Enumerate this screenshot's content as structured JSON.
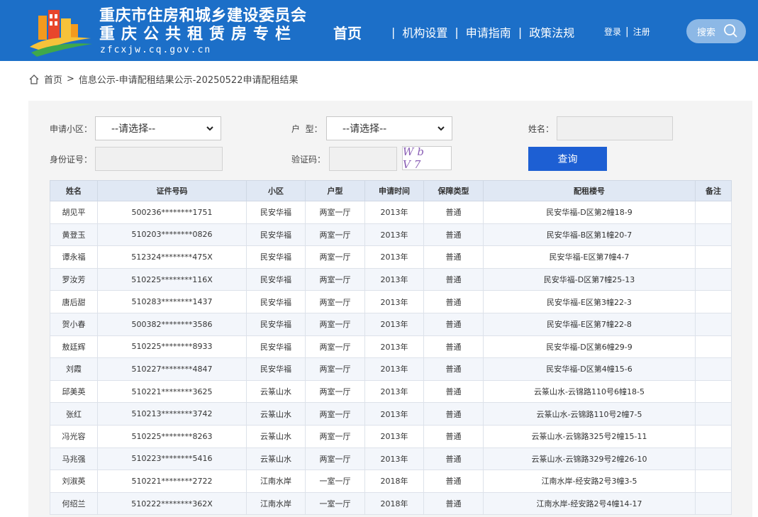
{
  "header": {
    "title": "重庆市住房和城乡建设委员会",
    "subtitle": "重庆公共租赁房专栏",
    "url": "zfcxjw.cq.gov.cn",
    "nav": {
      "home": "首页",
      "items": [
        "机构设置",
        "申请指南",
        "政策法规"
      ],
      "login": "登录",
      "register": "注册"
    },
    "search_label": "搜索"
  },
  "breadcrumb": {
    "home": "首页",
    "path": "信息公示-申请配租结果公示-20250522申请配租结果"
  },
  "form": {
    "community_label": "申请小区：",
    "community_value": "--请选择--",
    "type_label": "户  型：",
    "type_value": "--请选择--",
    "name_label": "姓名：",
    "id_label": "身份证号：",
    "captcha_label": "验证码：",
    "captcha_text": "Wb V7",
    "query_button": "查询"
  },
  "table": {
    "columns": [
      "姓名",
      "证件号码",
      "小区",
      "户型",
      "申请时间",
      "保障类型",
      "配租楼号",
      "备注"
    ],
    "rows": [
      [
        "胡见平",
        "500236********1751",
        "民安华福",
        "两室一厅",
        "2013年",
        "普通",
        "民安华福-D区第2幢18-9",
        ""
      ],
      [
        "黄登玉",
        "510203********0826",
        "民安华福",
        "两室一厅",
        "2013年",
        "普通",
        "民安华福-B区第1幢20-7",
        ""
      ],
      [
        "谭永福",
        "512324********475X",
        "民安华福",
        "两室一厅",
        "2013年",
        "普通",
        "民安华福-E区第7幢4-7",
        ""
      ],
      [
        "罗汝芳",
        "510225********116X",
        "民安华福",
        "两室一厅",
        "2013年",
        "普通",
        "民安华福-D区第7幢25-13",
        ""
      ],
      [
        "唐后甜",
        "510283********1437",
        "民安华福",
        "两室一厅",
        "2013年",
        "普通",
        "民安华福-E区第3幢22-3",
        ""
      ],
      [
        "贺小春",
        "500382********3586",
        "民安华福",
        "两室一厅",
        "2013年",
        "普通",
        "民安华福-E区第7幢22-8",
        ""
      ],
      [
        "敖廷辉",
        "510225********8933",
        "民安华福",
        "两室一厅",
        "2013年",
        "普通",
        "民安华福-D区第6幢29-9",
        ""
      ],
      [
        "刘霞",
        "510227********4847",
        "民安华福",
        "两室一厅",
        "2013年",
        "普通",
        "民安华福-D区第4幢15-6",
        ""
      ],
      [
        "邱美英",
        "510221********3625",
        "云篆山水",
        "两室一厅",
        "2013年",
        "普通",
        "云篆山水-云锦路110号6幢18-5",
        ""
      ],
      [
        "张红",
        "510213********3742",
        "云篆山水",
        "两室一厅",
        "2013年",
        "普通",
        "云篆山水-云锦路110号2幢7-5",
        ""
      ],
      [
        "冯光容",
        "510225********8263",
        "云篆山水",
        "两室一厅",
        "2013年",
        "普通",
        "云篆山水-云锦路325号2幢15-11",
        ""
      ],
      [
        "马兆强",
        "510223********5416",
        "云篆山水",
        "两室一厅",
        "2013年",
        "普通",
        "云篆山水-云锦路329号2幢26-10",
        ""
      ],
      [
        "刘淑英",
        "510221********2722",
        "江南水岸",
        "一室一厅",
        "2018年",
        "普通",
        "江南水岸-经安路2号3幢3-5",
        ""
      ],
      [
        "何绍兰",
        "510222********362X",
        "江南水岸",
        "一室一厅",
        "2018年",
        "普通",
        "江南水岸-经安路2号4幢14-17",
        ""
      ]
    ]
  }
}
